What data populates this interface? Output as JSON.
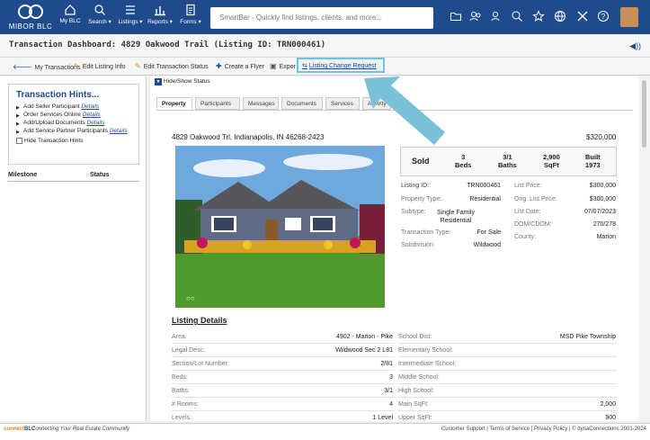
{
  "nav": {
    "logo": "MIBOR BLC",
    "items": [
      {
        "label": "My BLC"
      },
      {
        "label": "Search ▾"
      },
      {
        "label": "Listings ▾"
      },
      {
        "label": "Reports ▾"
      },
      {
        "label": "Forms ▾"
      }
    ],
    "smartbar_placeholder": "SmartBar - Quickly find listings, clients, and more...",
    "right_icons": [
      "folder-icon",
      "contacts-icon",
      "user-add-icon",
      "search-icon",
      "star-icon",
      "globe-icon",
      "tools-icon",
      "help-icon"
    ]
  },
  "titlebar": {
    "title": "Transaction Dashboard: 4829 Oakwood Trail (Listing ID: TRN000461)"
  },
  "actions": [
    {
      "label": "My Transactions",
      "icon": "back-arrow-icon"
    },
    {
      "label": "Edit Listing Info",
      "icon": "pencil-icon"
    },
    {
      "label": "Edit Transaction Status",
      "icon": "pencil-icon"
    },
    {
      "label": "Create a Flyer",
      "icon": "plus-icon"
    },
    {
      "label": "Expor",
      "icon": "export-icon"
    },
    {
      "label": "Listing Change Request",
      "icon": "request-icon"
    }
  ],
  "sidebar": {
    "hints_title": "Transaction Hints...",
    "hints": [
      {
        "text": "Add Seller Participant",
        "link": "Details"
      },
      {
        "text": "Order Services Online",
        "link": "Details"
      },
      {
        "text": "Add/Upload Documents",
        "link": "Details"
      },
      {
        "text": "Add Service Partner Participants",
        "link": "Details"
      }
    ],
    "hide_hints": "Hide Transaction Hints",
    "col_milestone": "Milestone",
    "col_status": "Status"
  },
  "content": {
    "hide_show": "Hide/Show Status",
    "tabs": [
      "Property",
      "Participants",
      "Messages",
      "Documents",
      "Services",
      "Activity"
    ],
    "address": "4829 Oakwood Trl, Indianapolis, IN 46268-2423",
    "price": "$320,000",
    "summary": {
      "status": "Sold",
      "beds_v": "3",
      "beds_l": "Beds",
      "baths_v": "3/1",
      "baths_l": "Baths",
      "sqft_v": "2,900",
      "sqft_l": "SqFt",
      "built_l": "Built",
      "built_v": "1973"
    },
    "left_kv": [
      {
        "k": "Listing ID:",
        "v": "TRN000461"
      },
      {
        "k": "Property Type:",
        "v": "Residential"
      },
      {
        "k": "Subtype:",
        "v": "Single Family Residential"
      },
      {
        "k": "Transaction Type:",
        "v": "For Sale"
      },
      {
        "k": "Subdivision:",
        "v": "Wildwood"
      }
    ],
    "right_kv": [
      {
        "k": "List Price:",
        "v": "$300,000"
      },
      {
        "k": "Orig. List Price:",
        "v": "$300,000"
      },
      {
        "k": "List Date:",
        "v": "07/07/2023"
      },
      {
        "k": "DOM/CDOM:",
        "v": "270/278"
      },
      {
        "k": "County:",
        "v": "Marion"
      }
    ],
    "listing_details_title": "Listing Details",
    "details_left": [
      {
        "k": "Area:",
        "v": "4902 - Marion - Pike"
      },
      {
        "k": "Legal Desc:",
        "v": "Wildwood Sec 2 L81"
      },
      {
        "k": "Section/Lot Number:",
        "v": "2/81"
      },
      {
        "k": "Beds:",
        "v": "3"
      },
      {
        "k": "Baths:",
        "v": "3/1"
      },
      {
        "k": "# Rooms:",
        "v": "4"
      },
      {
        "k": "Levels:",
        "v": "1 Level"
      }
    ],
    "details_right": [
      {
        "k": "School Dist:",
        "v": "MSD Pike Township"
      },
      {
        "k": "Elementary School:",
        "v": ""
      },
      {
        "k": "Intermediate School:",
        "v": ""
      },
      {
        "k": "Middle School:",
        "v": ""
      },
      {
        "k": "High School:",
        "v": ""
      },
      {
        "k": "Main SqFt:",
        "v": "2,000"
      },
      {
        "k": "Upper SqFt:",
        "v": "900"
      }
    ]
  },
  "footer": {
    "brand_a": "connect",
    "brand_b": "BLC",
    "tagline": "Connecting Your Real Estate Community",
    "links": "Customer Support | Terms of Service | Privacy Policy | © dynaConnections 2001-2024"
  }
}
